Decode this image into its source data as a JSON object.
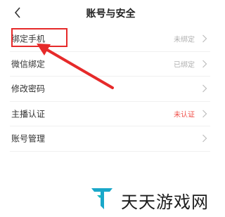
{
  "header": {
    "title": "账号与安全",
    "back_icon": "chevron-left-icon"
  },
  "rows": [
    {
      "label": "绑定手机",
      "status": "未绑定"
    },
    {
      "label": "微信绑定",
      "status": "已绑定"
    },
    {
      "label": "修改密码",
      "status": ""
    },
    {
      "label": "主播认证",
      "status": "未认证"
    },
    {
      "label": "账号管理",
      "status": ""
    }
  ],
  "watermark": {
    "text": "天天游戏网"
  },
  "colors": {
    "accent_red": "#e62a2a",
    "warn_red": "#f0504a",
    "logo_teal": "#1aa7c9"
  }
}
